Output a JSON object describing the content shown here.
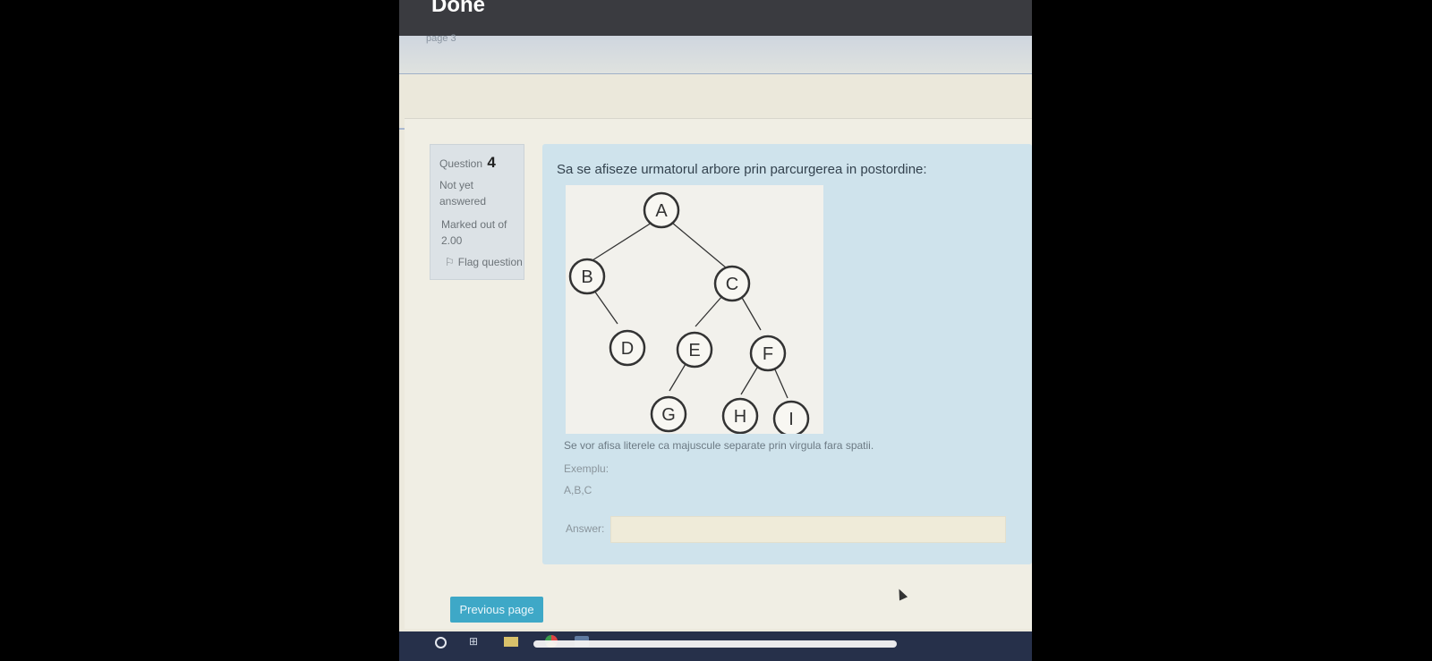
{
  "viewer": {
    "done_label": "Done",
    "page_strip_text": "page 3"
  },
  "question_info": {
    "label": "Question",
    "number": "4",
    "status": "Not yet answered",
    "marked": "Marked out of 2.00",
    "flag_label": "Flag question"
  },
  "question": {
    "text": "Sa se afiseze urmatorul arbore prin parcurgerea in postordine:",
    "tree_nodes": [
      "A",
      "B",
      "C",
      "D",
      "E",
      "F",
      "G",
      "H",
      "I"
    ],
    "instruction": "Se vor afisa literele ca majuscule separate prin virgula fara spatii.",
    "example_label": "Exemplu:",
    "example_value": "A,B,C",
    "answer_label": "Answer:",
    "answer_value": ""
  },
  "navigation": {
    "previous_page_label": "Previous page"
  },
  "colors": {
    "accent": "#3ea8c7",
    "question_box": "#cfe3ec",
    "info_box": "#dce2e6"
  }
}
